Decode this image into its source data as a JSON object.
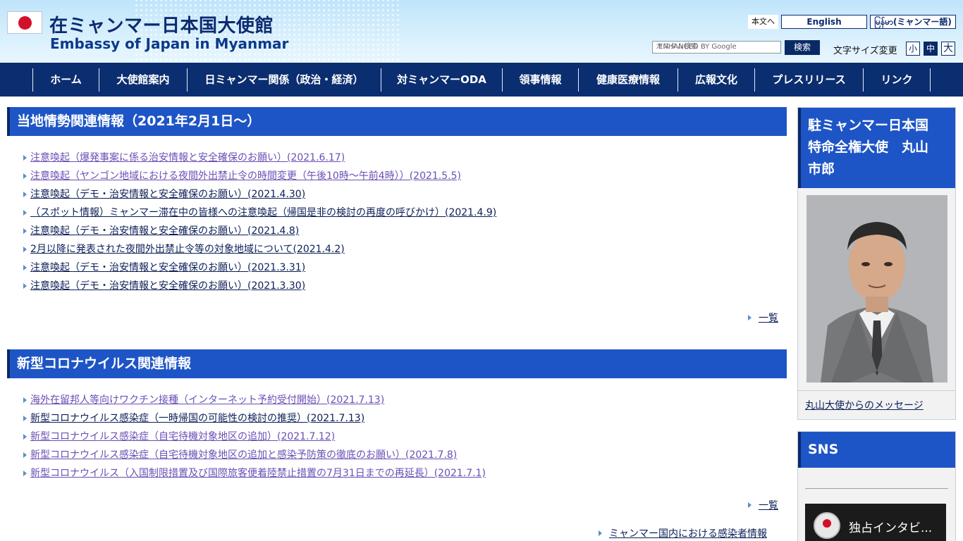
{
  "header": {
    "title_ja": "在ミャンマー日本国大使館",
    "title_en": "Embassy of Japan in Myanmar",
    "skip_link": "本文へ",
    "lang_english": "English",
    "lang_myanmar": "မြန်မာ(ミャンマー語)",
    "search_placeholder": "カスタム検索",
    "search_brand": "ENHANCED BY Google",
    "search_button": "検索",
    "font_size_label": "文字サイズ変更",
    "font_small": "小",
    "font_mid": "中",
    "font_large": "大"
  },
  "nav": {
    "items": [
      "ホーム",
      "大使館案内",
      "日ミャンマー関係（政治・経済）",
      "対ミャンマーODA",
      "領事情報",
      "健康医療情報",
      "広報文化",
      "プレスリリース",
      "リンク"
    ]
  },
  "section1": {
    "title": "当地情勢関連情報（2021年2月1日～）",
    "items": [
      "注意喚起（爆発事案に係る治安情報と安全確保のお願い）(2021.6.17)",
      "注意喚起（ヤンゴン地域における夜間外出禁止令の時間変更（午後10時～午前4時））(2021.5.5)",
      "注意喚起（デモ・治安情報と安全確保のお願い）(2021.4.30)",
      "（スポット情報）ミャンマー滞在中の皆様への注意喚起（帰国是非の検討の再度の呼びかけ）(2021.4.9)",
      "注意喚起（デモ・治安情報と安全確保のお願い）(2021.4.8)",
      "2月以降に発表された夜間外出禁止令等の対象地域について(2021.4.2)",
      "注意喚起（デモ・治安情報と安全確保のお願い）(2021.3.31)",
      "注意喚起（デモ・治安情報と安全確保のお願い）(2021.3.30)"
    ],
    "more": "一覧"
  },
  "section2": {
    "title": "新型コロナウイルス関連情報",
    "items": [
      "海外在留邦人等向けワクチン接種（インターネット予約受付開始）(2021.7.13)",
      "新型コロナウイルス感染症（一時帰国の可能性の検討の推奨）(2021.7.13)",
      "新型コロナウイルス感染症（自宅待機対象地区の追加）(2021.7.12)",
      "新型コロナウイルス感染症（自宅待機対象地区の追加と感染予防策の徹底のお願い）(2021.7.8)",
      "新型コロナウイルス（入国制限措置及び国際旅客便着陸禁止措置の7月31日までの再延長）(2021.7.1)"
    ],
    "more": "一覧",
    "extra_link": "ミャンマー国内における感染者情報"
  },
  "sidebar": {
    "ambassador_title_line1": "駐ミャンマー日本国",
    "ambassador_title_line2": "特命全権大使　丸山",
    "ambassador_title_line3": "市郎",
    "message_link": "丸山大使からのメッセージ",
    "sns_title": "SNS",
    "video_title": "独占インタビ..."
  },
  "colors": {
    "nav_bg": "#0b2e70",
    "section_head_bg": "#1e55c6",
    "link_visited": "#6a4fb5",
    "link_default": "#0b1f57",
    "flag_red": "#d3102a"
  }
}
